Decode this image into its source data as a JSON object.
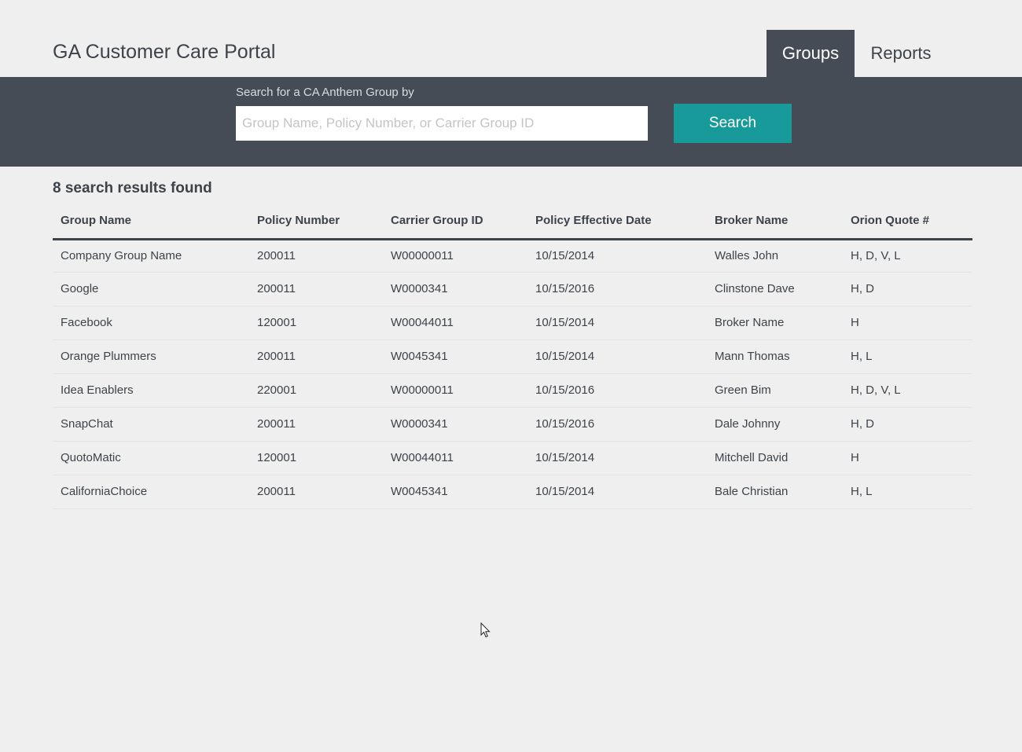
{
  "app": {
    "title": "GA Customer Care Portal"
  },
  "nav": {
    "tabs": [
      {
        "label": "Groups",
        "active": true
      },
      {
        "label": "Reports",
        "active": false
      }
    ]
  },
  "search": {
    "label": "Search for a CA Anthem Group by",
    "placeholder": "Group Name, Policy Number, or Carrier Group ID",
    "value": "",
    "button_label": "Search"
  },
  "results": {
    "count_text": "8 search results found",
    "columns": [
      "Group Name",
      "Policy Number",
      "Carrier Group ID",
      "Policy Effective Date",
      "Broker Name",
      "Orion Quote #"
    ],
    "rows": [
      [
        "Company Group Name",
        "200011",
        "W00000011",
        "10/15/2014",
        "Walles John",
        "H, D, V, L"
      ],
      [
        "Google",
        "200011",
        "W0000341",
        "10/15/2016",
        "Clinstone Dave",
        "H, D"
      ],
      [
        "Facebook",
        "120001",
        "W00044011",
        "10/15/2014",
        "Broker Name",
        "H"
      ],
      [
        "Orange Plummers",
        "200011",
        "W0045341",
        "10/15/2014",
        "Mann Thomas",
        "H, L"
      ],
      [
        "Idea Enablers",
        "220001",
        "W00000011",
        "10/15/2016",
        "Green Bim",
        "H, D, V, L"
      ],
      [
        "SnapChat",
        "200011",
        "W0000341",
        "10/15/2016",
        "Dale Johnny",
        "H, D"
      ],
      [
        "QuotoMatic",
        "120001",
        "W00044011",
        "10/15/2014",
        "Mitchell David",
        "H"
      ],
      [
        "CaliforniaChoice",
        "200011",
        "W0045341",
        "10/15/2014",
        "Bale Christian",
        "H, L"
      ]
    ]
  },
  "colors": {
    "header_band": "#464c55",
    "accent_button": "#18999a",
    "page_background": "#efefef",
    "text": "#3d434b"
  },
  "icons": {
    "cursor": "mouse-pointer-icon"
  }
}
